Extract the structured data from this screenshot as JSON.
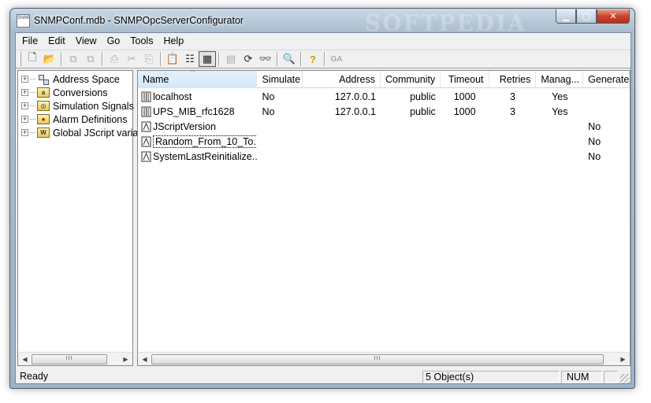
{
  "window": {
    "title": "SNMPConf.mdb - SNMPOpcServerConfigurator",
    "icon_text": "SNMP",
    "watermark": "SOFTPEDIA",
    "controls": [
      "minimize-icon",
      "maximize-icon",
      "close-icon"
    ]
  },
  "menu": [
    "File",
    "Edit",
    "View",
    "Go",
    "Tools",
    "Help"
  ],
  "toolbar": {
    "buttons": [
      {
        "icon": "new-document-icon",
        "glyph": "🗋"
      },
      {
        "icon": "open-folder-icon",
        "glyph": "📂"
      },
      {
        "icon": "copy-object-icon",
        "glyph": "⧉"
      },
      {
        "icon": "paste-object-icon",
        "glyph": "⧉"
      },
      {
        "icon": "print-icon",
        "glyph": "⎙"
      },
      {
        "icon": "cut-icon",
        "glyph": "✂"
      },
      {
        "icon": "copy-icon",
        "glyph": "⎘"
      },
      {
        "icon": "paste-icon",
        "glyph": "📋"
      },
      {
        "icon": "list-view-icon",
        "glyph": "☷"
      },
      {
        "icon": "details-view-icon",
        "glyph": "▦"
      },
      {
        "icon": "properties-icon",
        "glyph": "▤"
      },
      {
        "icon": "refresh-icon",
        "glyph": "⟳"
      },
      {
        "icon": "glasses-icon",
        "glyph": "👓"
      },
      {
        "icon": "find-icon",
        "glyph": "🔍"
      },
      {
        "icon": "help-icon",
        "glyph": "?"
      }
    ],
    "ga_label": "GA"
  },
  "tree": [
    {
      "label": "Address Space",
      "icon": "address-space-icon"
    },
    {
      "label": "Conversions",
      "icon": "conversions-folder-icon",
      "mark": "a"
    },
    {
      "label": "Simulation Signals",
      "icon": "simulation-folder-icon",
      "mark": "◎"
    },
    {
      "label": "Alarm Definitions",
      "icon": "alarm-folder-icon",
      "mark": "●"
    },
    {
      "label": "Global JScript variables",
      "icon": "jscript-folder-icon",
      "mark": "W"
    }
  ],
  "list": {
    "columns": [
      "Name",
      "Simulate",
      "Address",
      "Community",
      "Timeout",
      "Retries",
      "Manag...",
      "Generate..."
    ],
    "rows": [
      {
        "name": "localhost",
        "type": "device",
        "simulate": "No",
        "address": "127.0.0.1",
        "community": "public",
        "timeout": "1000",
        "retries": "3",
        "managed": "Yes",
        "generate": ""
      },
      {
        "name": "UPS_MIB_rfc1628",
        "type": "device",
        "simulate": "No",
        "address": "127.0.0.1",
        "community": "public",
        "timeout": "1000",
        "retries": "3",
        "managed": "Yes",
        "generate": ""
      },
      {
        "name": "JScriptVersion",
        "type": "variable",
        "simulate": "",
        "address": "",
        "community": "",
        "timeout": "",
        "retries": "",
        "managed": "",
        "generate": "No"
      },
      {
        "name": "Random_From_10_To...",
        "type": "variable",
        "simulate": "",
        "address": "",
        "community": "",
        "timeout": "",
        "retries": "",
        "managed": "",
        "generate": "No"
      },
      {
        "name": "SystemLastReinitialize...",
        "type": "variable",
        "simulate": "",
        "address": "",
        "community": "",
        "timeout": "",
        "retries": "",
        "managed": "",
        "generate": "No"
      }
    ]
  },
  "scroll_grip": "III",
  "status": {
    "ready": "Ready",
    "objects": "5 Object(s)",
    "num": "NUM"
  }
}
